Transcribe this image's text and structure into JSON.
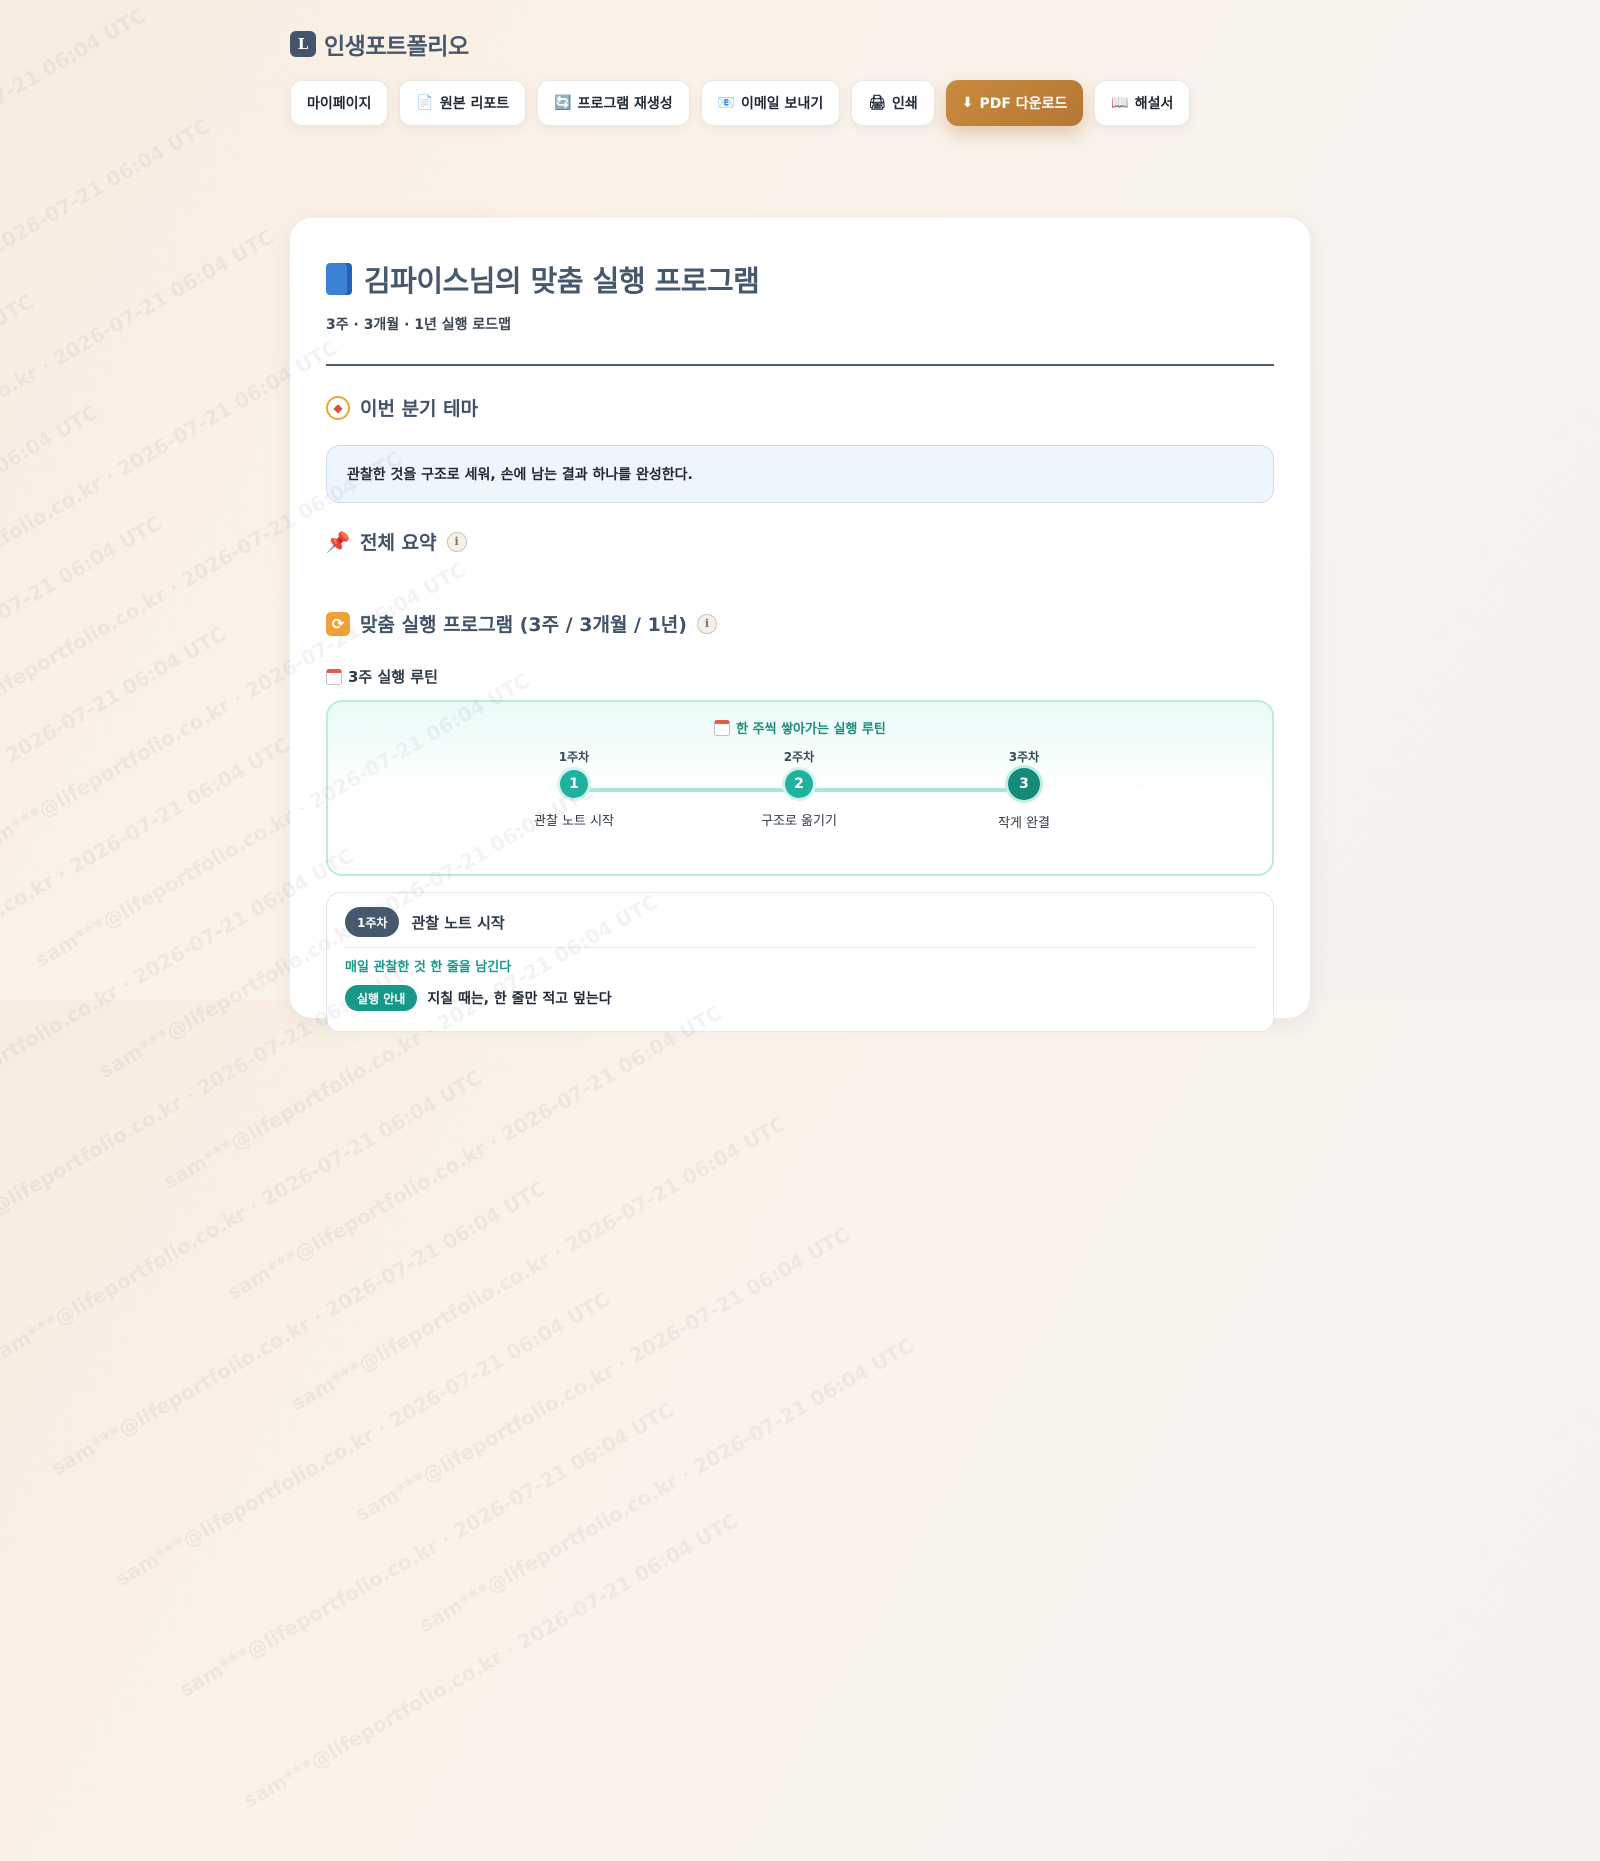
{
  "brand": {
    "logo_letter": "L",
    "name": "인생포트폴리오"
  },
  "toolbar": [
    {
      "icon": "",
      "label": "마이페이지"
    },
    {
      "icon": "📄",
      "label": "원본 리포트"
    },
    {
      "icon": "🔄",
      "label": "프로그램 재생성"
    },
    {
      "icon": "📧",
      "label": "이메일 보내기"
    },
    {
      "icon": "🖨",
      "label": "인쇄"
    },
    {
      "icon": "⬇",
      "label": "PDF 다운로드"
    },
    {
      "icon": "📖",
      "label": "해설서"
    }
  ],
  "page": {
    "title": "김파이스님의 맞춤 실행 프로그램",
    "subtitle": "3주 · 3개월 · 1년 실행 로드맵"
  },
  "sections": {
    "theme": {
      "title": "이번 분기 테마",
      "text": "관찰한 것을 구조로 세워, 손에 남는 결과 하나를 완성한다."
    },
    "summary": {
      "title": "전체 요약",
      "info": "i"
    },
    "program": {
      "title": "맞춤 실행 프로그램 (3주 / 3개월 / 1년)",
      "info": "i"
    }
  },
  "routine": {
    "label": "3주 실행 루틴",
    "heading": "한 주씩 쌓아가는 실행 루틴",
    "steps": [
      {
        "week": "1주차",
        "num": "1",
        "text": "관찰 노트 시작"
      },
      {
        "week": "2주차",
        "num": "2",
        "text": "구조로 옮기기"
      },
      {
        "week": "3주차",
        "num": "3",
        "text": "작게 완결"
      }
    ]
  },
  "week_card": {
    "badge": "1주차",
    "title": "관찰 노트 시작",
    "goal": "매일 관찰한 것 한 줄을 남긴다",
    "tip_badge": "실행 안내",
    "tip_text": "지칠 때는, 한 줄만 적고 덮는다"
  },
  "watermark": "sam***@lifeportfolio.co.kr · 2026-07-21 06:04 UTC",
  "colors": {
    "brand": "#45586e",
    "primary_button": "#c0823a",
    "teal": "#1fb39f",
    "theme_box": "#eef5fd"
  }
}
